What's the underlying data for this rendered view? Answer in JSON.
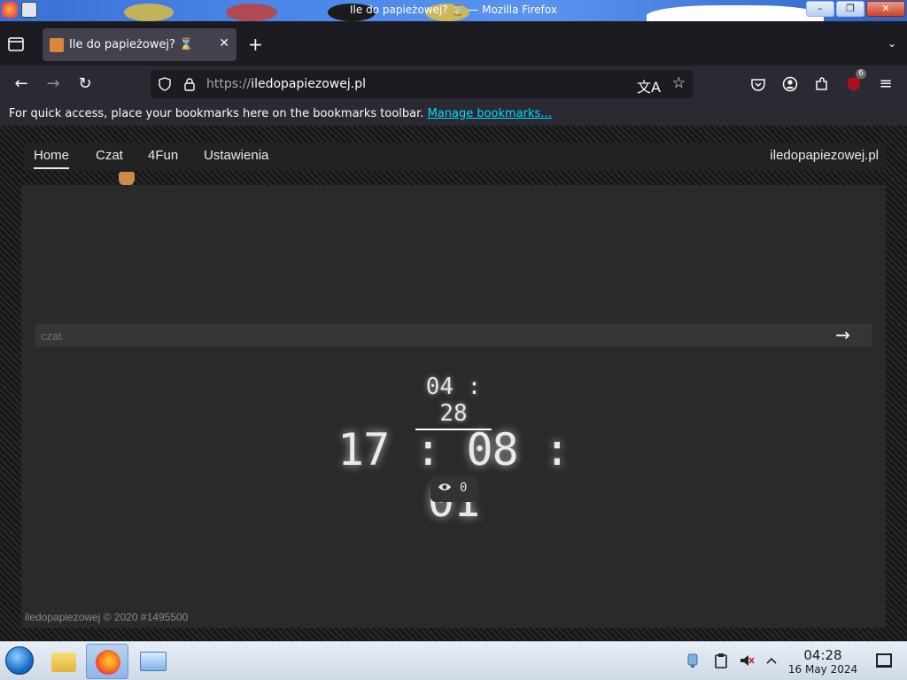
{
  "window": {
    "title": "Ile do papieżowej? ⌛ — Mozilla Firefox",
    "minimize_label": "–",
    "maximize_label": "❐",
    "close_label": "✕"
  },
  "tabs": {
    "list_icon": "tab-list-icon",
    "active_title": "Ile do papieżowej? ⌛",
    "close_label": "✕",
    "new_tab_label": "+",
    "all_tabs_label": "⌄"
  },
  "navbar": {
    "back_label": "←",
    "forward_label": "→",
    "reload_label": "↻",
    "url_scheme": "https://",
    "url_host": "iledopapiezowej.pl",
    "translate_label": "文A",
    "bookmark_label": "☆",
    "extension_badge": "6",
    "menu_label": "≡"
  },
  "bookmarks_bar": {
    "message": "For quick access, place your bookmarks here on the bookmarks toolbar.",
    "manage_link": "Manage bookmarks…"
  },
  "site": {
    "nav": [
      {
        "label": "Home",
        "active": true
      },
      {
        "label": "Czat",
        "active": false
      },
      {
        "label": "4Fun",
        "active": false
      },
      {
        "label": "Ustawienia",
        "active": false
      }
    ],
    "brand": "iledopapiezowej.pl",
    "chat_placeholder": "czat",
    "send_label": "→",
    "current_time": "04 : 28",
    "countdown": "17 : 08 : 01",
    "viewers_icon": "eye-icon",
    "viewers_count": "0",
    "footer": "iledopapiezowej © 2020 #1495500"
  },
  "taskbar": {
    "time": "04:28",
    "date": "16 May 2024"
  },
  "colors": {
    "accent_link": "#00ddff",
    "browser_chrome": "#2b2a33",
    "page_panel": "#2a2a2a"
  }
}
